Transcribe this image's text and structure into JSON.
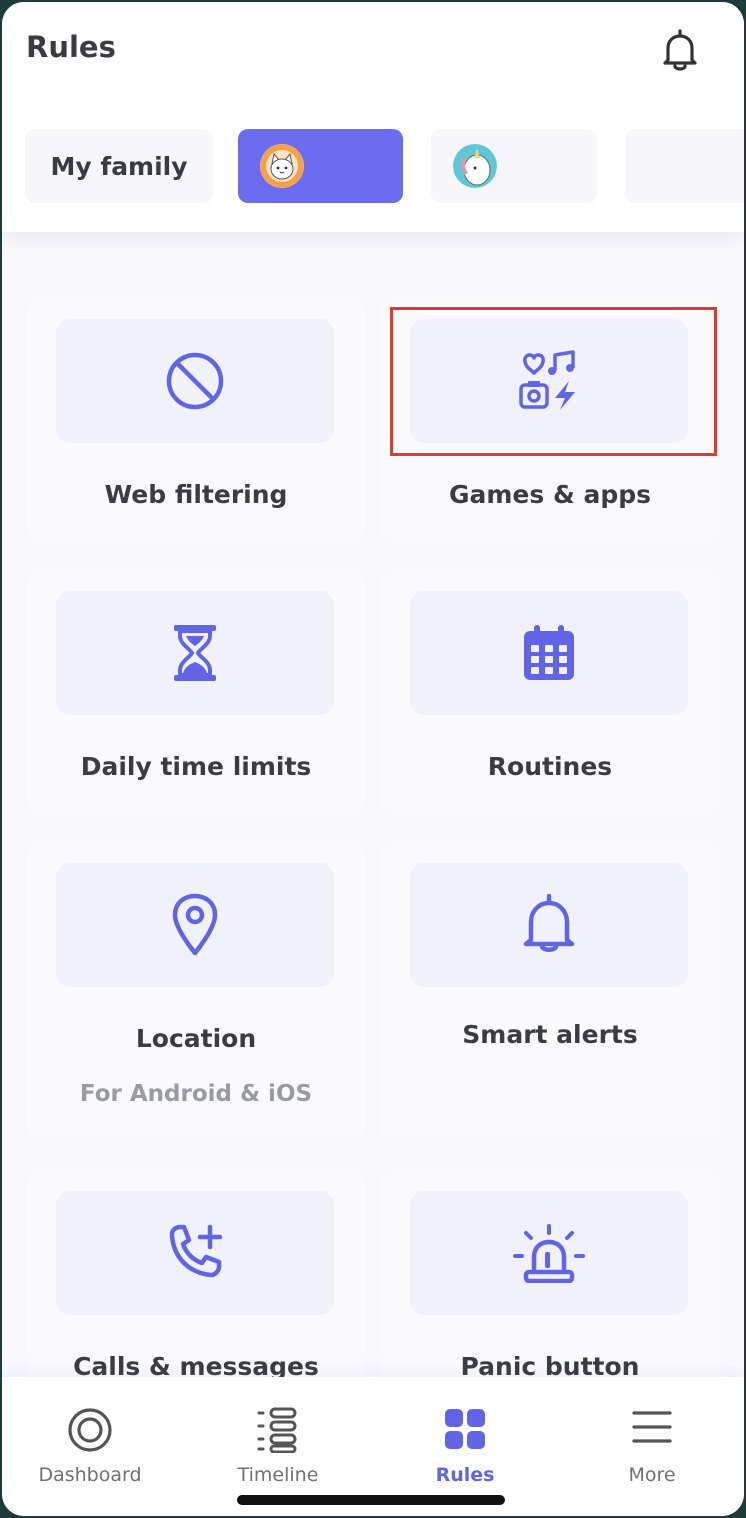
{
  "header": {
    "title": "Rules",
    "icons": {
      "notifications": "bell-icon"
    }
  },
  "profiles": {
    "family_label": "My family",
    "children": [
      {
        "avatar": "cat-avatar-icon",
        "selected": true
      },
      {
        "avatar": "unicorn-avatar-icon",
        "selected": false
      },
      {
        "avatar": "",
        "selected": false
      }
    ]
  },
  "rules": {
    "web_filtering": {
      "label": "Web filtering",
      "icon": "block-icon"
    },
    "games_apps": {
      "label": "Games & apps",
      "icon": "apps-icon"
    },
    "daily_time_limits": {
      "label": "Daily time limits",
      "icon": "hourglass-icon"
    },
    "routines": {
      "label": "Routines",
      "icon": "calendar-icon"
    },
    "location": {
      "label": "Location",
      "sublabel": "For Android & iOS",
      "icon": "location-pin-icon"
    },
    "smart_alerts": {
      "label": "Smart alerts",
      "icon": "bell-icon"
    },
    "calls_messages": {
      "label": "Calls & messages",
      "icon": "phone-plus-icon"
    },
    "panic_button": {
      "label": "Panic button",
      "icon": "siren-icon"
    }
  },
  "nav": {
    "dashboard": "Dashboard",
    "timeline": "Timeline",
    "rules": "Rules",
    "more": "More",
    "active": "rules"
  },
  "colors": {
    "accent": "#6264E6",
    "tile_bg": "#F1F1FB",
    "highlight": "#E0392E",
    "text": "#3B3B42"
  }
}
